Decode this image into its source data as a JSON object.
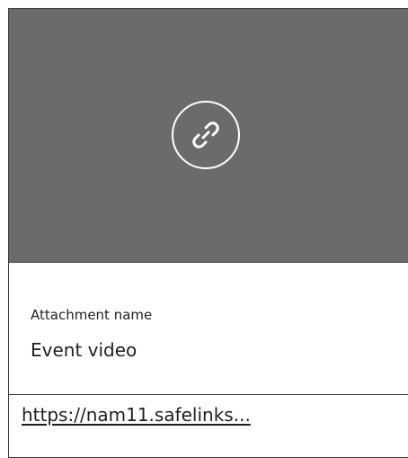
{
  "attachment": {
    "icon": "link-icon",
    "name_label": "Attachment name",
    "name_value": "Event video",
    "url_text": "https://nam11.safelinks..."
  },
  "colors": {
    "preview_background": "#6b6b6b",
    "border": "#3a3a3a",
    "text": "#1f1f1f",
    "icon": "#ffffff"
  }
}
